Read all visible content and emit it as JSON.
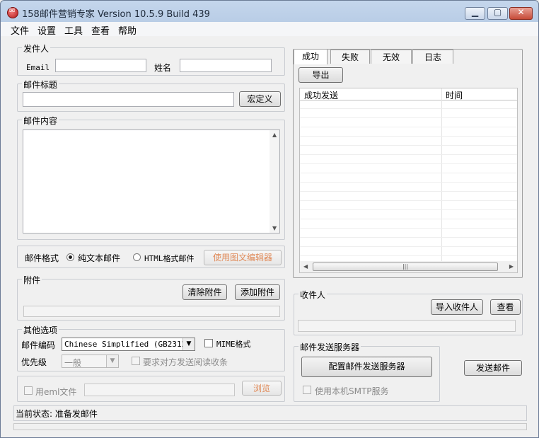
{
  "window": {
    "title": "158邮件营销专家 Version 10.5.9 Build 439"
  },
  "menu": [
    "文件",
    "设置",
    "工具",
    "查看",
    "帮助"
  ],
  "sender": {
    "group_label": "发件人",
    "email_label": "Email",
    "email_value": "",
    "name_label": "姓名",
    "name_value": ""
  },
  "subject": {
    "group_label": "邮件标题",
    "value": "",
    "macro_button": "宏定义"
  },
  "content": {
    "group_label": "邮件内容",
    "value": ""
  },
  "format": {
    "label": "邮件格式",
    "plain_label": "纯文本邮件",
    "html_label": "HTML格式邮件",
    "selected": "plain",
    "editor_button": "使用图文编辑器"
  },
  "attachment": {
    "group_label": "附件",
    "clear_button": "清除附件",
    "add_button": "添加附件"
  },
  "other": {
    "group_label": "其他选项",
    "encoding_label": "邮件编码",
    "encoding_value": "Chinese Simplified (GB2312)",
    "mime_label": "MIME格式",
    "priority_label": "优先级",
    "priority_value": "一般",
    "receipt_label": "要求对方发送阅读收条"
  },
  "eml": {
    "checkbox_label": "用eml文件",
    "browse_button": "浏览"
  },
  "tabs": [
    "成功",
    "失败",
    "无效",
    "日志"
  ],
  "results": {
    "export_button": "导出",
    "columns": [
      "成功发送",
      "时间"
    ],
    "rows": []
  },
  "recipients": {
    "group_label": "收件人",
    "import_button": "导入收件人",
    "view_button": "查看"
  },
  "server": {
    "group_label": "邮件发送服务器",
    "config_button": "配置邮件发送服务器",
    "local_smtp_label": "使用本机SMTP服务"
  },
  "send_button": "发送邮件",
  "status": {
    "text": "当前状态: 准备发邮件"
  },
  "colors": {
    "disabled_text": "#e08b5a",
    "title_bar": "#c4d6ec"
  }
}
